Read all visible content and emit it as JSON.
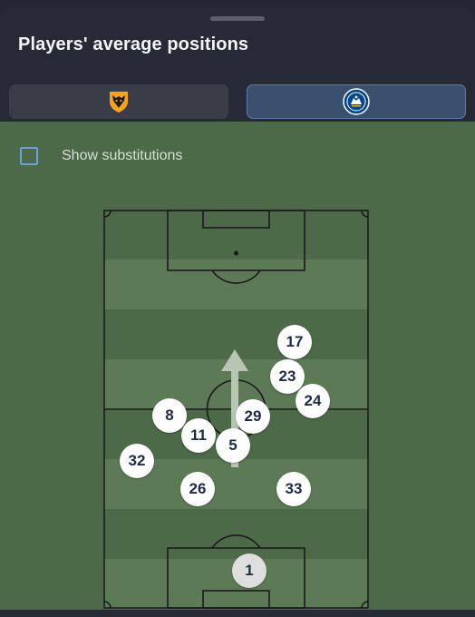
{
  "header": {
    "title": "Players' average positions"
  },
  "tabs": [
    {
      "name": "tab-wolves",
      "icon": "wolves-crest-icon",
      "selected": false
    },
    {
      "name": "tab-chelsea",
      "icon": "chelsea-crest-icon",
      "selected": true
    }
  ],
  "options": {
    "show_substitutions_label": "Show substitutions",
    "show_substitutions_checked": false
  },
  "colors": {
    "pitch": "#4c6a47",
    "pitch_light_stripe": "#5b7a55",
    "selected_tab": "#3b506f",
    "checkbox": "#6fa0d8",
    "wolves": "#f9a21b",
    "chelsea": "#034694"
  },
  "attack_direction": "up",
  "players": [
    {
      "number": "17"
    },
    {
      "number": "23"
    },
    {
      "number": "24"
    },
    {
      "number": "29"
    },
    {
      "number": "8"
    },
    {
      "number": "11"
    },
    {
      "number": "5"
    },
    {
      "number": "32"
    },
    {
      "number": "26"
    },
    {
      "number": "33"
    },
    {
      "number": "1"
    }
  ]
}
